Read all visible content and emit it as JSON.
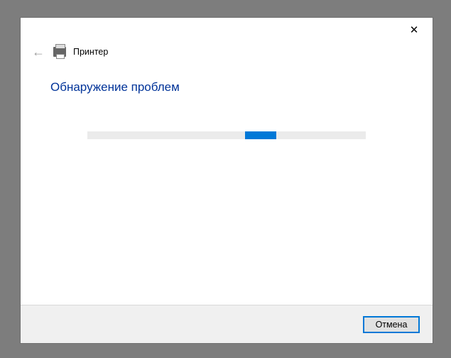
{
  "window": {
    "title": "Принтер",
    "heading": "Обнаружение проблем"
  },
  "footer": {
    "cancel_label": "Отмена"
  },
  "icons": {
    "close": "✕",
    "back": "←"
  },
  "progress": {
    "indeterminate": true
  }
}
